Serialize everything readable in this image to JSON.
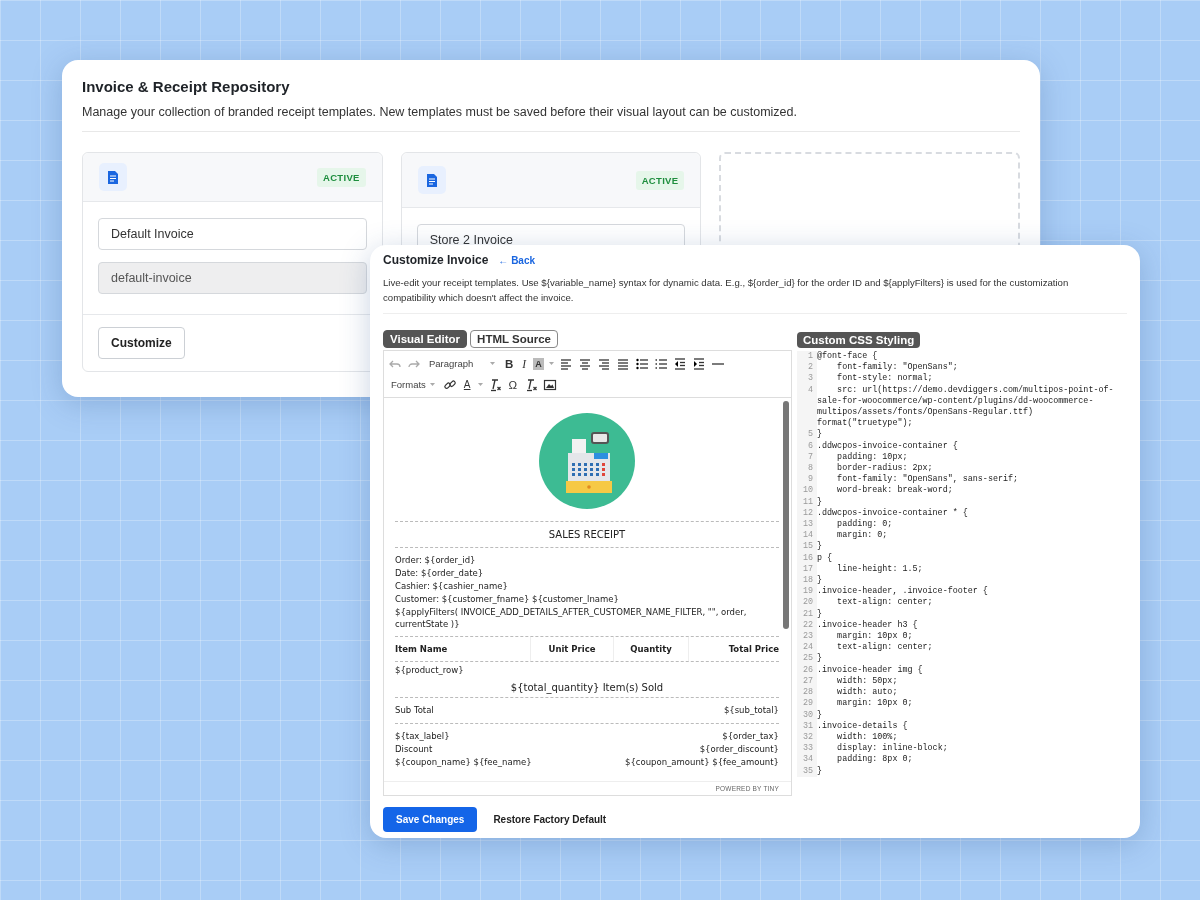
{
  "repository": {
    "title": "Invoice & Receipt Repository",
    "description": "Manage your collection of branded receipt templates. New templates must be saved before their visual layout can be customized.",
    "templates": [
      {
        "kind": "template",
        "status": "ACTIVE",
        "name": "Default Invoice",
        "slug": "default-invoice",
        "button": "Customize"
      },
      {
        "kind": "template",
        "status": "ACTIVE",
        "name": "Store 2 Invoice"
      },
      {
        "kind": "new"
      }
    ]
  },
  "customizer": {
    "title": "Customize Invoice",
    "back_link": "← Back",
    "description": "Live-edit your receipt templates. Use ${variable_name} syntax for dynamic data. E.g., ${order_id} for the order ID and ${applyFilters} is used for the customization compatibility which doesn't affect the invoice.",
    "tabs": [
      {
        "label": "Visual Editor",
        "selected": true
      },
      {
        "label": "HTML Source",
        "selected": false
      }
    ],
    "toolbar": [
      [
        {
          "kind": "icon"
        },
        {
          "kind": "icon"
        },
        {
          "kind": "dropdown",
          "label": "Paragraph"
        },
        {
          "kind": "glyph",
          "text": "B"
        },
        {
          "kind": "glyph",
          "text": "I"
        },
        {
          "kind": "glyph",
          "text": "A"
        },
        {
          "kind": "icon"
        },
        {
          "kind": "icon"
        },
        {
          "kind": "icon"
        },
        {
          "kind": "icon"
        },
        {
          "kind": "icon"
        },
        {
          "kind": "icon"
        },
        {
          "kind": "icon"
        },
        {
          "kind": "icon"
        },
        {
          "kind": "icon"
        }
      ],
      [
        {
          "kind": "dropdown",
          "label": "Formats"
        },
        {
          "kind": "icon"
        },
        {
          "kind": "glyph",
          "text": "A"
        },
        {
          "kind": "icon"
        },
        {
          "kind": "glyph",
          "text": "Ω"
        },
        {
          "kind": "icon"
        },
        {
          "kind": "icon"
        }
      ]
    ],
    "receipt": {
      "heading": "SALES RECEIPT",
      "details": [
        "Order: ${order_id}",
        "Date: ${order_date}",
        "Cashier: ${cashier_name}",
        "Customer: ${customer_fname} ${customer_lname}",
        "${applyFilters( INVOICE_ADD_DETAILS_AFTER_CUSTOMER_NAME_FILTER, \"\", order, currentState )}"
      ],
      "columns": [
        "Item Name",
        "Unit Price",
        "Quantity",
        "Total Price"
      ],
      "product_row": "${product_row}",
      "items_sold": "${total_quantity} Item(s) Sold",
      "subtotal": {
        "label": "Sub Total",
        "value": "${sub_total}"
      },
      "charges": [
        {
          "label": "${tax_label}",
          "value": "${order_tax}"
        },
        {
          "label": "Discount",
          "value": "${order_discount}"
        },
        {
          "label": "${coupon_name} ${fee_name}",
          "value": "${coupon_amount} ${fee_amount}"
        }
      ]
    },
    "branding": "POWERED BY TINY",
    "css_label": "Custom CSS Styling",
    "css_lines": [
      {
        "number": "1",
        "code": "@font-face {"
      },
      {
        "number": "2",
        "code": "    font-family: \"OpenSans\";"
      },
      {
        "number": "3",
        "code": "    font-style: normal;"
      },
      {
        "number": "4",
        "code": "    src: url(https://demo.devdiggers.com/multipos-point-of-sale-for-woocommerce/wp-content/plugins/dd-woocommerce-multipos/assets/fonts/OpenSans-Regular.ttf) format(\"truetype\");"
      },
      {
        "number": "5",
        "code": "}"
      },
      {
        "number": "6",
        "code": ".ddwcpos-invoice-container {"
      },
      {
        "number": "7",
        "code": "    padding: 10px;"
      },
      {
        "number": "8",
        "code": "    border-radius: 2px;"
      },
      {
        "number": "9",
        "code": "    font-family: \"OpenSans\", sans-serif;"
      },
      {
        "number": "10",
        "code": "    word-break: break-word;"
      },
      {
        "number": "11",
        "code": "}"
      },
      {
        "number": "12",
        "code": ".ddwcpos-invoice-container * {"
      },
      {
        "number": "13",
        "code": "    padding: 0;"
      },
      {
        "number": "14",
        "code": "    margin: 0;"
      },
      {
        "number": "15",
        "code": "}"
      },
      {
        "number": "16",
        "code": "p {"
      },
      {
        "number": "17",
        "code": "    line-height: 1.5;"
      },
      {
        "number": "18",
        "code": "}"
      },
      {
        "number": "19",
        "code": ".invoice-header, .invoice-footer {"
      },
      {
        "number": "20",
        "code": "    text-align: center;"
      },
      {
        "number": "21",
        "code": "}"
      },
      {
        "number": "22",
        "code": ".invoice-header h3 {"
      },
      {
        "number": "23",
        "code": "    margin: 10px 0;"
      },
      {
        "number": "24",
        "code": "    text-align: center;"
      },
      {
        "number": "25",
        "code": "}"
      },
      {
        "number": "26",
        "code": ".invoice-header img {"
      },
      {
        "number": "27",
        "code": "    width: 50px;"
      },
      {
        "number": "28",
        "code": "    width: auto;"
      },
      {
        "number": "29",
        "code": "    margin: 10px 0;"
      },
      {
        "number": "30",
        "code": "}"
      },
      {
        "number": "31",
        "code": ".invoice-details {"
      },
      {
        "number": "32",
        "code": "    width: 100%;"
      },
      {
        "number": "33",
        "code": "    display: inline-block;"
      },
      {
        "number": "34",
        "code": "    padding: 8px 0;"
      },
      {
        "number": "35",
        "code": "}"
      }
    ],
    "actions": {
      "save": "Save Changes",
      "restore": "Restore Factory Default"
    }
  }
}
